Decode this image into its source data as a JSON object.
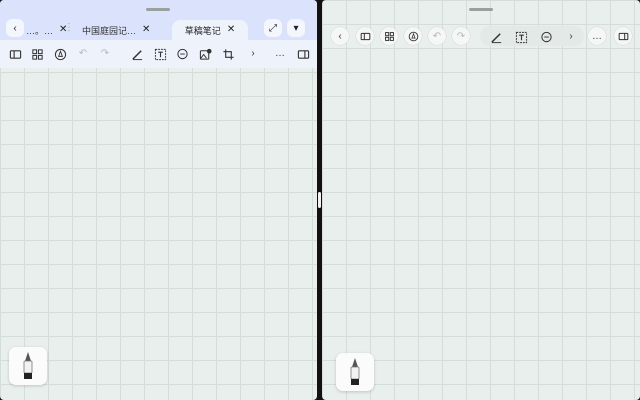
{
  "left_pane": {
    "tabs": [
      {
        "label": "…。…",
        "close": "✕"
      },
      {
        "label": "中国庭园记…",
        "close": "✕"
      },
      {
        "label": "草稿笔记",
        "close": "✕",
        "active": true
      }
    ],
    "back_glyph": "‹",
    "expand_glyph": "⤢",
    "menu_glyph": "▾",
    "tab_separator": "⋮",
    "toolbar": {
      "undo_glyph": "↶",
      "redo_glyph": "↷",
      "next_glyph": "›",
      "more_glyph": "…"
    }
  },
  "right_pane": {
    "toolbar": {
      "back_glyph": "‹",
      "undo_glyph": "↶",
      "redo_glyph": "↷",
      "next_glyph": "›",
      "more_glyph": "…"
    }
  },
  "colors": {
    "canvas": "#e8efec",
    "grid": "#d5ddd9",
    "tab_bar": "#dbe2fc",
    "toolbar": "#eef2fb",
    "divider": "#111111"
  }
}
